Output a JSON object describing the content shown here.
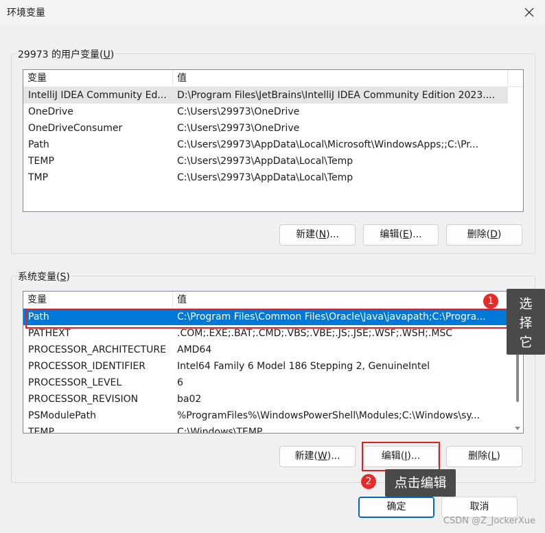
{
  "window": {
    "title": "环境变量"
  },
  "user_vars": {
    "group_label_prefix": "29973 的用户变量(",
    "group_label_key": "U",
    "group_label_suffix": ")",
    "headers": [
      "变量",
      "值"
    ],
    "rows": [
      {
        "name": "IntelliJ IDEA Community Ed...",
        "value": "D:\\Program Files\\JetBrains\\IntelliJ IDEA Community Edition 2023...."
      },
      {
        "name": "OneDrive",
        "value": "C:\\Users\\29973\\OneDrive"
      },
      {
        "name": "OneDriveConsumer",
        "value": "C:\\Users\\29973\\OneDrive"
      },
      {
        "name": "Path",
        "value": "C:\\Users\\29973\\AppData\\Local\\Microsoft\\WindowsApps;;C:\\Pr..."
      },
      {
        "name": "TEMP",
        "value": "C:\\Users\\29973\\AppData\\Local\\Temp"
      },
      {
        "name": "TMP",
        "value": "C:\\Users\\29973\\AppData\\Local\\Temp"
      }
    ],
    "buttons": {
      "new": {
        "prefix": "新建(",
        "key": "N",
        "suffix": ")..."
      },
      "edit": {
        "prefix": "编辑(",
        "key": "E",
        "suffix": ")..."
      },
      "delete": {
        "prefix": "删除(",
        "key": "D",
        "suffix": ")"
      }
    }
  },
  "system_vars": {
    "group_label_prefix": "系统变量(",
    "group_label_key": "S",
    "group_label_suffix": ")",
    "headers": [
      "变量",
      "值"
    ],
    "rows": [
      {
        "name": "Path",
        "value": "C:\\Program Files\\Common Files\\Oracle\\Java\\javapath;C:\\Progra...",
        "selected": true
      },
      {
        "name": "PATHEXT",
        "value": ".COM;.EXE;.BAT;.CMD;.VBS;.VBE;.JS;.JSE;.WSF;.WSH;.MSC"
      },
      {
        "name": "PROCESSOR_ARCHITECTURE",
        "value": "AMD64"
      },
      {
        "name": "PROCESSOR_IDENTIFIER",
        "value": "Intel64 Family 6 Model 186 Stepping 2, GenuineIntel"
      },
      {
        "name": "PROCESSOR_LEVEL",
        "value": "6"
      },
      {
        "name": "PROCESSOR_REVISION",
        "value": "ba02"
      },
      {
        "name": "PSModulePath",
        "value": "%ProgramFiles%\\WindowsPowerShell\\Modules;C:\\Windows\\sy..."
      },
      {
        "name": "TEMP",
        "value": "C:\\Windows\\TEMP"
      }
    ],
    "buttons": {
      "new": {
        "prefix": "新建(",
        "key": "W",
        "suffix": ")..."
      },
      "edit": {
        "prefix": "编辑(",
        "key": "I",
        "suffix": ")..."
      },
      "delete": {
        "prefix": "删除(",
        "key": "L",
        "suffix": ")"
      }
    }
  },
  "footer": {
    "ok": "确定",
    "cancel": "取消"
  },
  "annotations": {
    "badge1": "1",
    "tip1": "选择它",
    "badge2": "2",
    "tip2": "点击编辑",
    "accent_color": "#e02020"
  },
  "watermark": "CSDN @Z_JockerXue"
}
